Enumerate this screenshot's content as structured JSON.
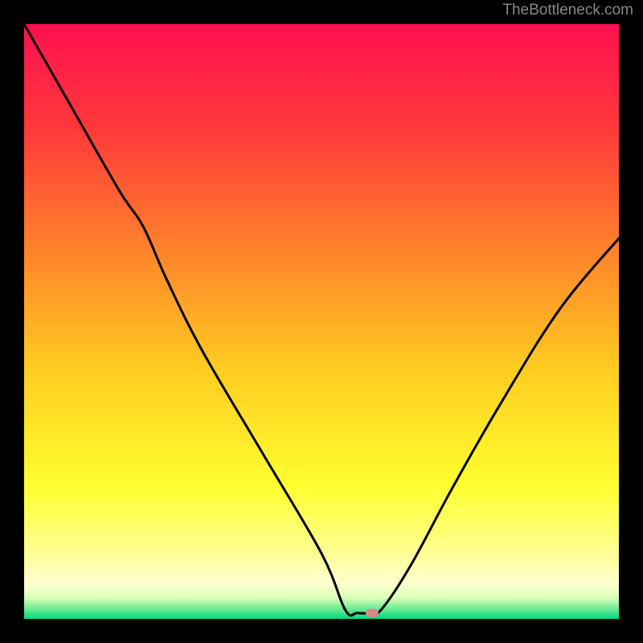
{
  "attribution": "TheBottleneck.com",
  "chart_data": {
    "type": "line",
    "title": "",
    "xlabel": "",
    "ylabel": "",
    "xlim": [
      0,
      100
    ],
    "ylim": [
      0,
      100
    ],
    "curve": [
      {
        "x": 0,
        "y": 100
      },
      {
        "x": 8,
        "y": 86
      },
      {
        "x": 16,
        "y": 72
      },
      {
        "x": 20,
        "y": 66
      },
      {
        "x": 24,
        "y": 57
      },
      {
        "x": 30,
        "y": 45
      },
      {
        "x": 40,
        "y": 28
      },
      {
        "x": 50,
        "y": 11
      },
      {
        "x": 54,
        "y": 1.5
      },
      {
        "x": 56,
        "y": 1.0
      },
      {
        "x": 58,
        "y": 1.0
      },
      {
        "x": 60,
        "y": 1.5
      },
      {
        "x": 65,
        "y": 9
      },
      {
        "x": 72,
        "y": 22
      },
      {
        "x": 80,
        "y": 36
      },
      {
        "x": 90,
        "y": 52
      },
      {
        "x": 100,
        "y": 64
      }
    ],
    "marker": {
      "x": 58.5,
      "y": 1.0
    },
    "gradient_stops": [
      {
        "offset": 0,
        "color": "#ff1050"
      },
      {
        "offset": 0.18,
        "color": "#ff3a3a"
      },
      {
        "offset": 0.4,
        "color": "#ff8a2a"
      },
      {
        "offset": 0.58,
        "color": "#ffcc20"
      },
      {
        "offset": 0.78,
        "color": "#ffff30"
      },
      {
        "offset": 0.9,
        "color": "#ffffa0"
      },
      {
        "offset": 0.94,
        "color": "#ffffd0"
      },
      {
        "offset": 0.965,
        "color": "#d8ffb8"
      },
      {
        "offset": 0.985,
        "color": "#60e890"
      },
      {
        "offset": 1.0,
        "color": "#00d880"
      }
    ]
  }
}
